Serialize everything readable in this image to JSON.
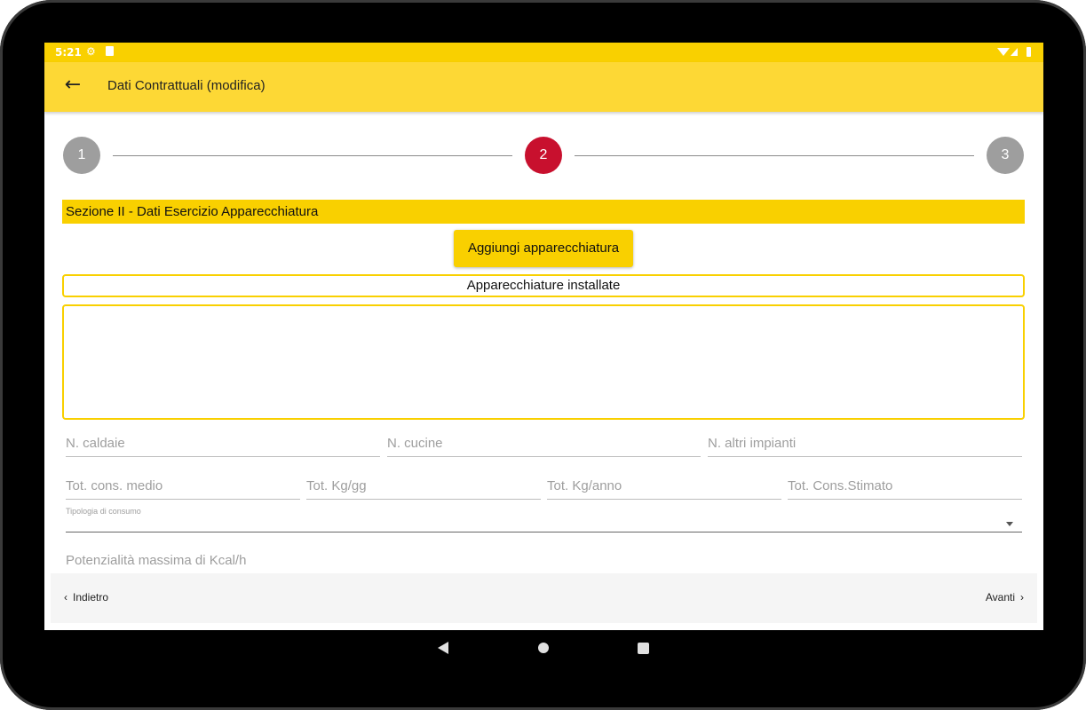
{
  "status_bar": {
    "time": "5:21",
    "icons": [
      "settings-icon",
      "sd-card-icon",
      "wifi-icon",
      "signal-icon",
      "battery-icon"
    ]
  },
  "app_bar": {
    "title": "Dati Contrattuali (modifica)",
    "back_icon": "arrow-back-icon"
  },
  "stepper": {
    "steps": [
      {
        "label": "1",
        "state": "inactive"
      },
      {
        "label": "2",
        "state": "active"
      },
      {
        "label": "3",
        "state": "inactive"
      }
    ],
    "active_color": "#c8102e",
    "inactive_color": "#9e9e9e"
  },
  "section": {
    "title": "Sezione II - Dati Esercizio Apparecchiatura"
  },
  "add_button": {
    "label": "Aggiungi apparecchiatura"
  },
  "installed": {
    "label": "Apparecchiature installate",
    "items": []
  },
  "fields_row1": [
    {
      "placeholder": "N. caldaie"
    },
    {
      "placeholder": "N. cucine"
    },
    {
      "placeholder": "N. altri impianti"
    }
  ],
  "fields_row2": [
    {
      "placeholder": "Tot. cons. medio"
    },
    {
      "placeholder": "Tot. Kg/gg"
    },
    {
      "placeholder": "Tot. Kg/anno"
    },
    {
      "placeholder": "Tot. Cons.Stimato"
    }
  ],
  "consumption_type": {
    "label": "Tipologia di consumo",
    "value": ""
  },
  "max_power": {
    "placeholder": "Potenzialità massima di Kcal/h"
  },
  "bottom_nav": {
    "back_label": "Indietro",
    "next_label": "Avanti"
  },
  "colors": {
    "brand_yellow": "#fdd835",
    "accent_yellow": "#f9d000"
  }
}
